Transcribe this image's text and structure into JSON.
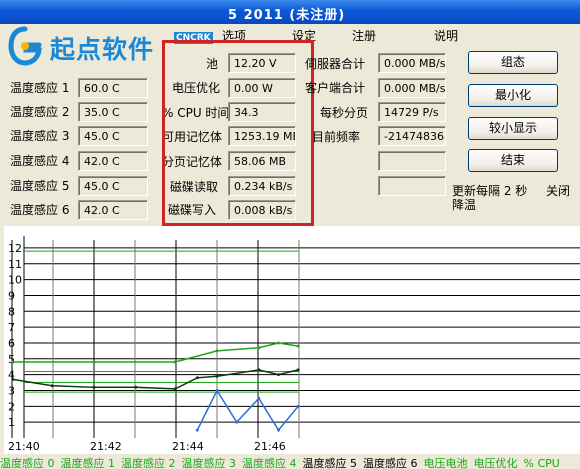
{
  "window": {
    "title": "5 2011 (未注册)"
  },
  "logo": {
    "text": "起点软件",
    "badge": "CNCRK"
  },
  "menu": [
    {
      "label": "选项"
    },
    {
      "label": "设定"
    },
    {
      "label": "注册"
    },
    {
      "label": "说明"
    }
  ],
  "temps": [
    {
      "label": "温度感应 1",
      "value": "60.0 C"
    },
    {
      "label": "温度感应 2",
      "value": "35.0 C"
    },
    {
      "label": "温度感应 3",
      "value": "45.0 C"
    },
    {
      "label": "温度感应 4",
      "value": "42.0 C"
    },
    {
      "label": "温度感应 5",
      "value": "45.0 C"
    },
    {
      "label": "温度感应 6",
      "value": "42.0 C"
    }
  ],
  "mid": [
    {
      "label": "池",
      "value": "12.20 V"
    },
    {
      "label": "电压优化",
      "value": "0.00 W"
    },
    {
      "label": "% CPU 时间",
      "value": "34.3"
    },
    {
      "label": "可用记忆体",
      "value": "1253.19 MB"
    },
    {
      "label": "分页记忆体",
      "value": "58.06 MB"
    },
    {
      "label": "磁碟读取",
      "value": "0.234 kB/s"
    },
    {
      "label": "磁碟写入",
      "value": "0.008 kB/s"
    }
  ],
  "net": [
    {
      "label": "伺服器合计",
      "value": "0.000 MB/s"
    },
    {
      "label": "客户端合计",
      "value": "0.000 MB/s"
    },
    {
      "label": "每秒分页",
      "value": "14729 P/s"
    },
    {
      "label": "目前频率",
      "value": "-214748368.0"
    },
    {
      "label": "",
      "value": ""
    },
    {
      "label": "",
      "value": ""
    }
  ],
  "buttons": {
    "config": "组态",
    "minimize": "最小化",
    "compact": "较小显示",
    "end": "结束"
  },
  "update_text": "更新每隔 2 秒",
  "close_text": "关闭",
  "cool_text": "降温",
  "colors": {
    "titlebar": "#0a58d6",
    "dark_series": "#0b3a0b",
    "green_series": "#1ea51e",
    "blue_series": "#2a6fd6",
    "highlight": "#d02323"
  },
  "chart_data": {
    "type": "line",
    "y_ticks": [
      "12",
      "11",
      "10",
      "9",
      "8",
      "7",
      "6",
      "5",
      "4",
      "3",
      "2",
      "1"
    ],
    "x_ticks": [
      "21:40",
      "21:42",
      "21:44",
      "21:46"
    ],
    "ylim": [
      0,
      12.5
    ],
    "grid": true,
    "series": [
      {
        "color": "#1ea51e",
        "x": [
          21.667,
          21.7,
          21.733,
          21.75,
          21.767,
          21.775,
          21.783
        ],
        "values": [
          4.8,
          4.8,
          4.8,
          5.5,
          5.7,
          6.0,
          5.8
        ]
      },
      {
        "color": "#0b3a0b",
        "x": [
          21.667,
          21.683,
          21.7,
          21.717,
          21.733,
          21.742,
          21.75,
          21.767,
          21.775,
          21.783
        ],
        "values": [
          3.7,
          3.3,
          3.2,
          3.2,
          3.1,
          3.8,
          3.9,
          4.3,
          4.0,
          4.3
        ]
      },
      {
        "color": "#2a6fd6",
        "x": [
          21.742,
          21.75,
          21.758,
          21.767,
          21.775,
          21.783
        ],
        "values": [
          0.5,
          3.0,
          1.0,
          2.5,
          0.5,
          2.0
        ]
      }
    ],
    "flat_lines": [
      {
        "color": "#1ea51e",
        "value": 11.8
      },
      {
        "color": "#1ea51e",
        "value": 4.2
      },
      {
        "color": "#1ea51e",
        "value": 3.5
      },
      {
        "color": "#1ea51e",
        "value": 2.9
      }
    ]
  },
  "legend": [
    {
      "label": "温度感应 0",
      "color": "#1ea51e"
    },
    {
      "label": "温度感应 1",
      "color": "#1ea51e"
    },
    {
      "label": "温度感应 2",
      "color": "#1ea51e"
    },
    {
      "label": "温度感应 3",
      "color": "#1ea51e"
    },
    {
      "label": "温度感应 4",
      "color": "#1ea51e"
    },
    {
      "label": "温度感应 5",
      "color": "#000000"
    },
    {
      "label": "温度感应 6",
      "color": "#000000"
    },
    {
      "label": "电压电池",
      "color": "#19a719"
    },
    {
      "label": "电压优化",
      "color": "#19a719"
    },
    {
      "label": "% CPU",
      "color": "#19a719"
    }
  ]
}
